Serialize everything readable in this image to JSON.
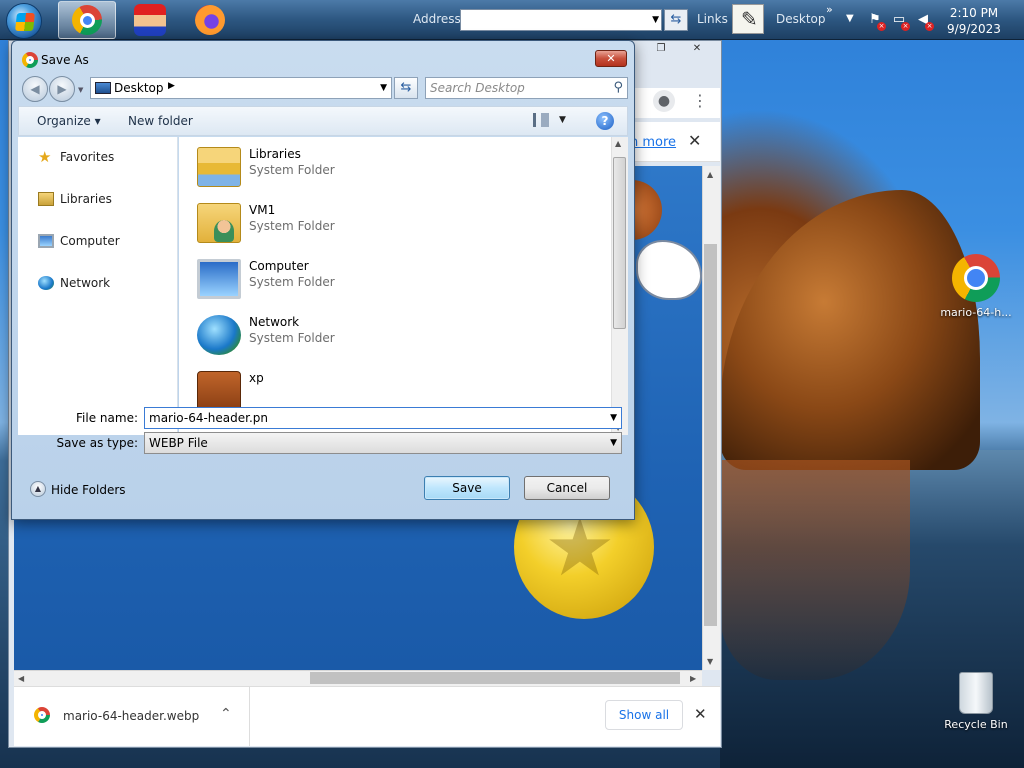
{
  "taskbar": {
    "address_label": "Address",
    "links_label": "Links",
    "desktop_label": "Desktop",
    "chevron": "»",
    "clock_time": "2:10 PM",
    "clock_date": "9/9/2023"
  },
  "desktop_icons": [
    {
      "label": "mario-64-h..."
    },
    {
      "label": "Recycle Bin"
    }
  ],
  "chrome": {
    "learn_more": "n more",
    "download_filename": "mario-64-header.webp",
    "show_all": "Show all"
  },
  "dialog": {
    "title": "Save As",
    "breadcrumb": "Desktop",
    "search_placeholder": "Search Desktop",
    "organize_label": "Organize ▾",
    "new_folder_label": "New folder",
    "nav_items": [
      {
        "label": "Favorites",
        "icon": "star-icon"
      },
      {
        "label": "Libraries",
        "icon": "libraries-icon"
      },
      {
        "label": "Computer",
        "icon": "computer-icon"
      },
      {
        "label": "Network",
        "icon": "network-icon"
      }
    ],
    "files": [
      {
        "name": "Libraries",
        "type": "System Folder",
        "icon": "libraries-folder-icon"
      },
      {
        "name": "VM1",
        "type": "System Folder",
        "icon": "user-folder-icon"
      },
      {
        "name": "Computer",
        "type": "System Folder",
        "icon": "computer-icon"
      },
      {
        "name": "Network",
        "type": "System Folder",
        "icon": "network-globe-icon"
      },
      {
        "name": "xp",
        "type": "",
        "icon": "briefcase-icon"
      }
    ],
    "file_name_label": "File name:",
    "file_name_value": "mario-64-header.pn",
    "save_type_label": "Save as type:",
    "save_type_value": "WEBP File",
    "hide_folders_label": "Hide Folders",
    "save_label": "Save",
    "cancel_label": "Cancel"
  },
  "colors": {
    "dialog_frame": "#b9d1ea",
    "close_button": "#c8503c",
    "link_blue": "#1a73e8",
    "desktop_sky": "#2d7fd8"
  }
}
